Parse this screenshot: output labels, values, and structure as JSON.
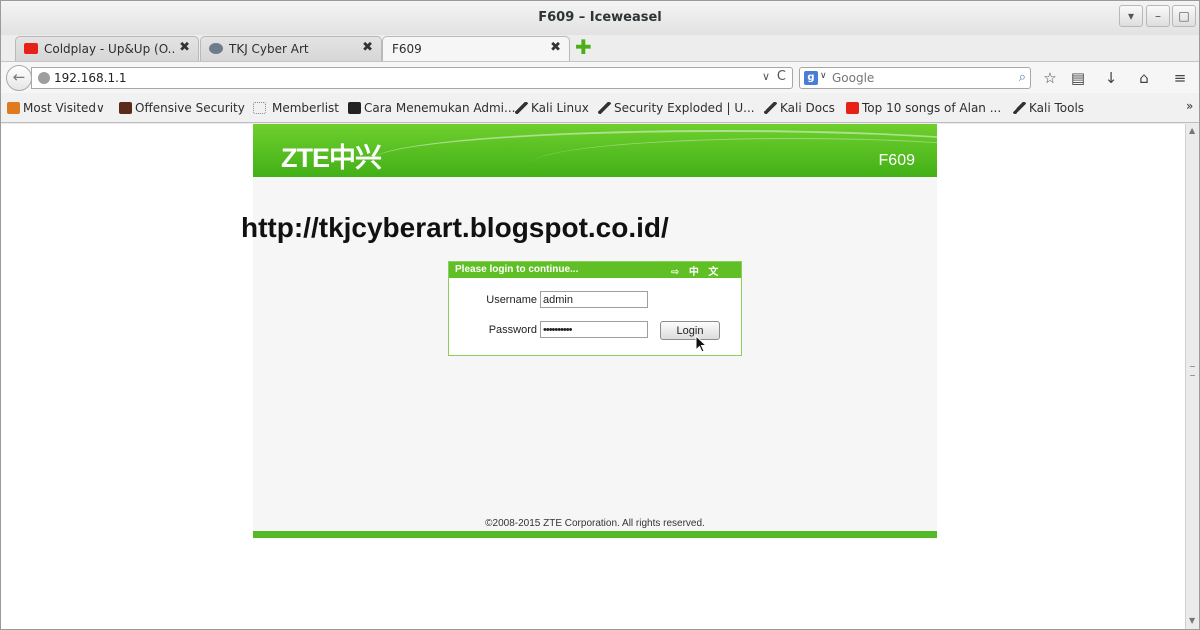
{
  "window": {
    "title": "F609 – Iceweasel",
    "controls": [
      "▾",
      "–",
      "□",
      "✕"
    ]
  },
  "tabs": [
    {
      "label": "Coldplay - Up&Up (O...",
      "close": "✖",
      "active": false
    },
    {
      "label": "TKJ Cyber Art",
      "close": "✖",
      "active": false
    },
    {
      "label": "F609",
      "close": "✖",
      "active": true
    }
  ],
  "new_tab": "✚",
  "navbar": {
    "back": "←",
    "url": "192.168.1.1",
    "url_dropdown": "∨",
    "reload": "C",
    "search_engine_letter": "g",
    "search_dropdown": "∨",
    "search_placeholder": "Google",
    "search_button": "⌕",
    "icons": [
      "☆",
      "▤",
      "↓",
      "⌂",
      "≡"
    ]
  },
  "bookmarks": [
    {
      "label": "Most Visited∨",
      "icon_color": "#e07a1f"
    },
    {
      "label": "Offensive Security",
      "icon_color": "#5a2a1a"
    },
    {
      "label": "Memberlist",
      "icon_color": "#ffffff"
    },
    {
      "label": "Cara Menemukan Admi...",
      "icon_color": "#222222"
    },
    {
      "label": "Kali Linux",
      "icon_color": "#333333"
    },
    {
      "label": "Security Exploded | U...",
      "icon_color": "#333333"
    },
    {
      "label": "Kali Docs",
      "icon_color": "#333333"
    },
    {
      "label": "Top 10 songs of Alan ...",
      "icon_color": "#e62117"
    },
    {
      "label": "Kali Tools",
      "icon_color": "#333333"
    }
  ],
  "bookmarks_more": "»",
  "router": {
    "logo": "ZTE中兴",
    "model": "F609",
    "login_title": "Please login to continue...",
    "language_switch": "⇨ 中 文",
    "username_label": "Username",
    "username_value": "admin",
    "password_label": "Password",
    "password_value": "••••••••••",
    "login_button": "Login",
    "copyright": "©2008-2015 ZTE Corporation. All rights reserved."
  },
  "overlay_text": "http://tkjcyberart.blogspot.co.id/",
  "colors": {
    "zte_green": "#4cb51e",
    "youtube_red": "#e62117"
  }
}
